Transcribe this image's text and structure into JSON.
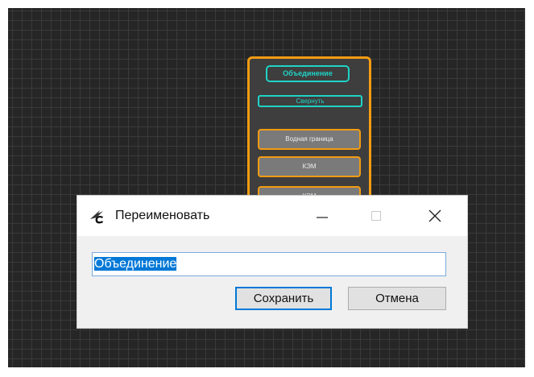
{
  "node": {
    "title": "Объединение",
    "collapse_label": "Свернуть",
    "items": [
      {
        "label": "Водная граница"
      },
      {
        "label": "КЭМ"
      },
      {
        "label": "КЭМ"
      }
    ]
  },
  "dialog": {
    "title": "Переименовать",
    "input_value": "Объединение",
    "save_label": "Сохранить",
    "cancel_label": "Отмена",
    "minimize_icon": "minimize-icon",
    "maximize_icon": "maximize-icon",
    "close_icon": "close-icon",
    "app_icon": "feather-c-app-icon"
  },
  "colors": {
    "canvas_bg": "#262626",
    "node_border": "#f39c12",
    "node_accent": "#1fd3c6",
    "selection": "#0078d7"
  }
}
